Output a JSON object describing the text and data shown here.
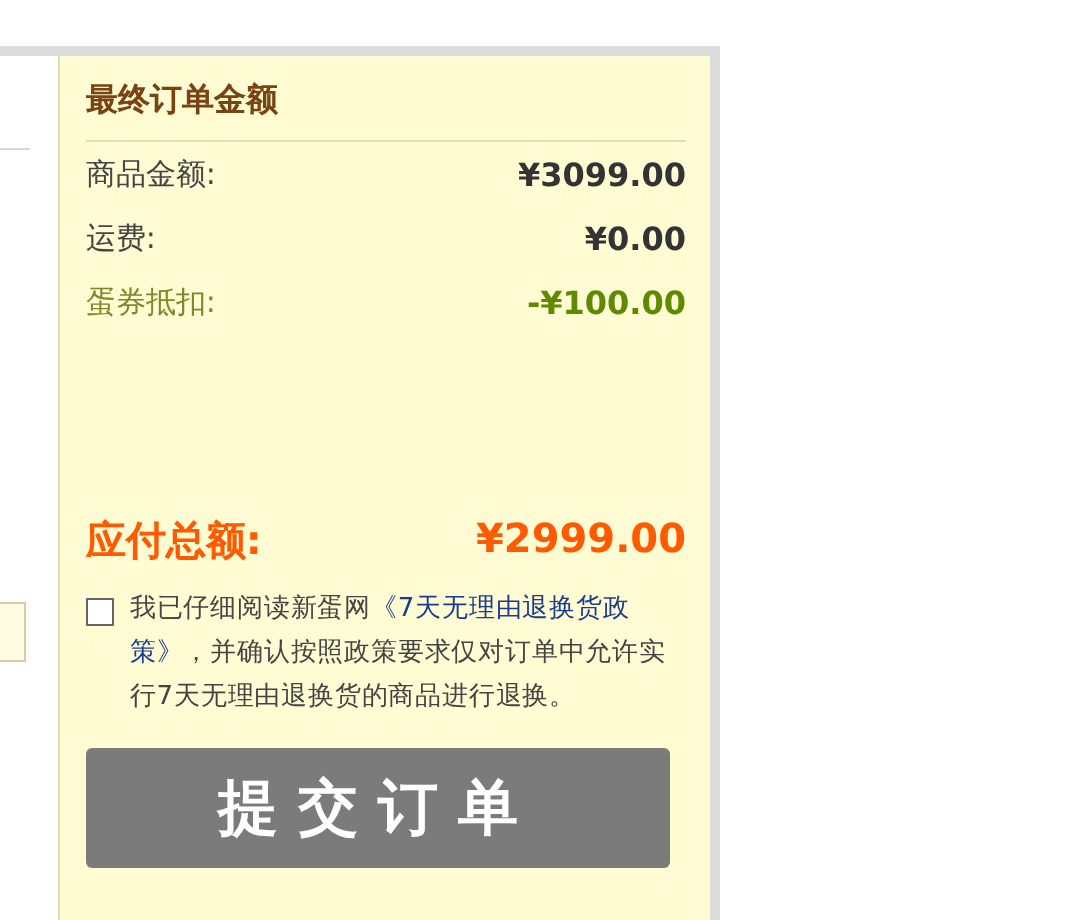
{
  "summary": {
    "title": "最终订单金额",
    "lines": [
      {
        "label": "商品金额:",
        "value": "¥3099.00",
        "kind": "normal"
      },
      {
        "label": "运费:",
        "value": "¥0.00",
        "kind": "normal"
      },
      {
        "label": "蛋券抵扣:",
        "value": "-¥100.00",
        "kind": "discount"
      }
    ],
    "total": {
      "label": "应付总额:",
      "value": "¥2999.00"
    },
    "agreement": {
      "checked": false,
      "before": "我已仔细阅读新蛋网",
      "link": [
        "《7天无理由退换货政",
        "策》"
      ],
      "after": "，并确认按照政策要求仅对订单中允许实行7天无理由退换货的商品进行退换。"
    },
    "submit": {
      "label": "提交订单",
      "disabled": true
    }
  }
}
